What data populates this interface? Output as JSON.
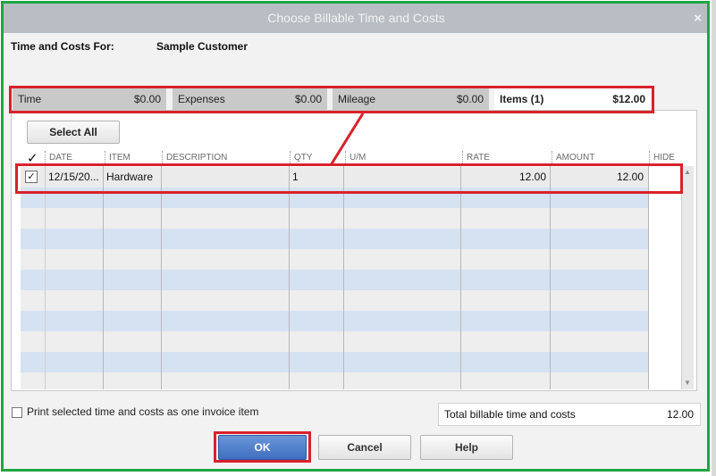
{
  "dialog": {
    "title": "Choose Billable Time and Costs",
    "close_label": "×"
  },
  "customer": {
    "label": "Time and Costs For:",
    "name": "Sample Customer"
  },
  "tabs": [
    {
      "label": "Time",
      "amount": "$0.00",
      "active": false
    },
    {
      "label": "Expenses",
      "amount": "$0.00",
      "active": false
    },
    {
      "label": "Mileage",
      "amount": "$0.00",
      "active": false
    },
    {
      "label": "Items (1)",
      "amount": "$12.00",
      "active": true
    }
  ],
  "select_all_label": "Select All",
  "columns": {
    "check": "✓",
    "date": "DATE",
    "item": "ITEM",
    "description": "DESCRIPTION",
    "qty": "QTY",
    "um": "U/M",
    "rate": "RATE",
    "amount": "AMOUNT",
    "hide": "HIDE"
  },
  "rows": [
    {
      "checked": true,
      "check_mark": "✓",
      "date": "12/15/20...",
      "item": "Hardware",
      "description": "",
      "qty": "1",
      "um": "",
      "rate": "12.00",
      "amount": "12.00",
      "hide": ""
    }
  ],
  "print_option": {
    "label": "Print selected time and costs as one invoice item",
    "checked": false
  },
  "total": {
    "label": "Total billable time and costs",
    "value": "12.00"
  },
  "buttons": {
    "ok": "OK",
    "cancel": "Cancel",
    "help": "Help"
  },
  "colors": {
    "highlight_red": "#d8222b",
    "frame_green": "#1fa643",
    "ok_blue": "#3f6fc0"
  }
}
